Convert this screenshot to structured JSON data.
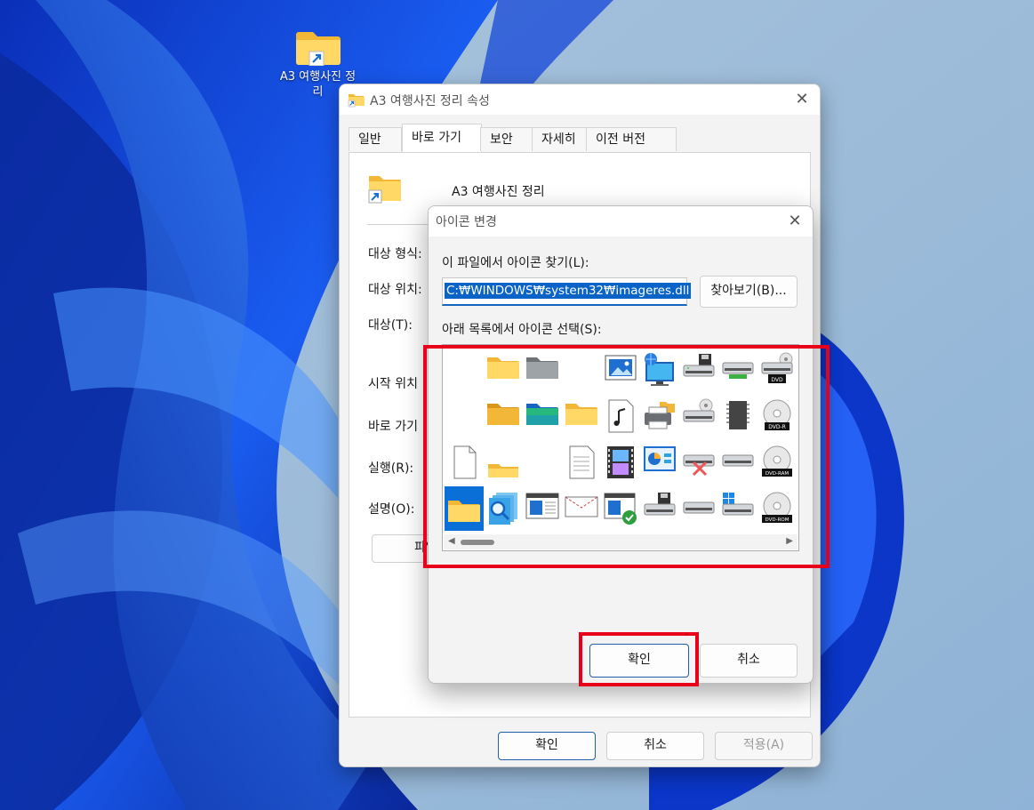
{
  "desktop": {
    "shortcut_label": "A3 여행사진 정리"
  },
  "properties_window": {
    "title": "A3 여행사진 정리 속성",
    "tabs": [
      "일반",
      "바로 가기",
      "보안",
      "자세히",
      "이전 버전"
    ],
    "active_tab": "바로 가기",
    "item_name": "A3 여행사진 정리",
    "fields": {
      "target_type": "대상 형식:",
      "target_location": "대상 위치:",
      "target": "대상(T):",
      "start_in": "시작 위치",
      "shortcut_key": "바로 가기",
      "run": "실행(R):",
      "comment": "설명(O):"
    },
    "open_location_button": "파일",
    "buttons": {
      "ok": "확인",
      "cancel": "취소",
      "apply": "적용(A)"
    }
  },
  "change_icon_dialog": {
    "title": "아이콘 변경",
    "file_label": "이 파일에서 아이콘 찾기(L):",
    "file_path": "C:₩WINDOWS₩system32₩imageres.dll",
    "browse_button": "찾아보기(B)...",
    "list_label": "아래 목록에서 아이콘 선택(S):",
    "icon_badges": {
      "dvd": "DVD",
      "dvd_r": "DVD-R",
      "dvd_ram": "DVD-RAM",
      "dvd_rom": "DVD-ROM"
    },
    "ok_button": "확인",
    "cancel_button": "취소",
    "selected_icon": "folder-icon"
  },
  "colors": {
    "highlight": "#e8001b",
    "selection": "#0a6fd6",
    "accent": "#1565c0"
  }
}
